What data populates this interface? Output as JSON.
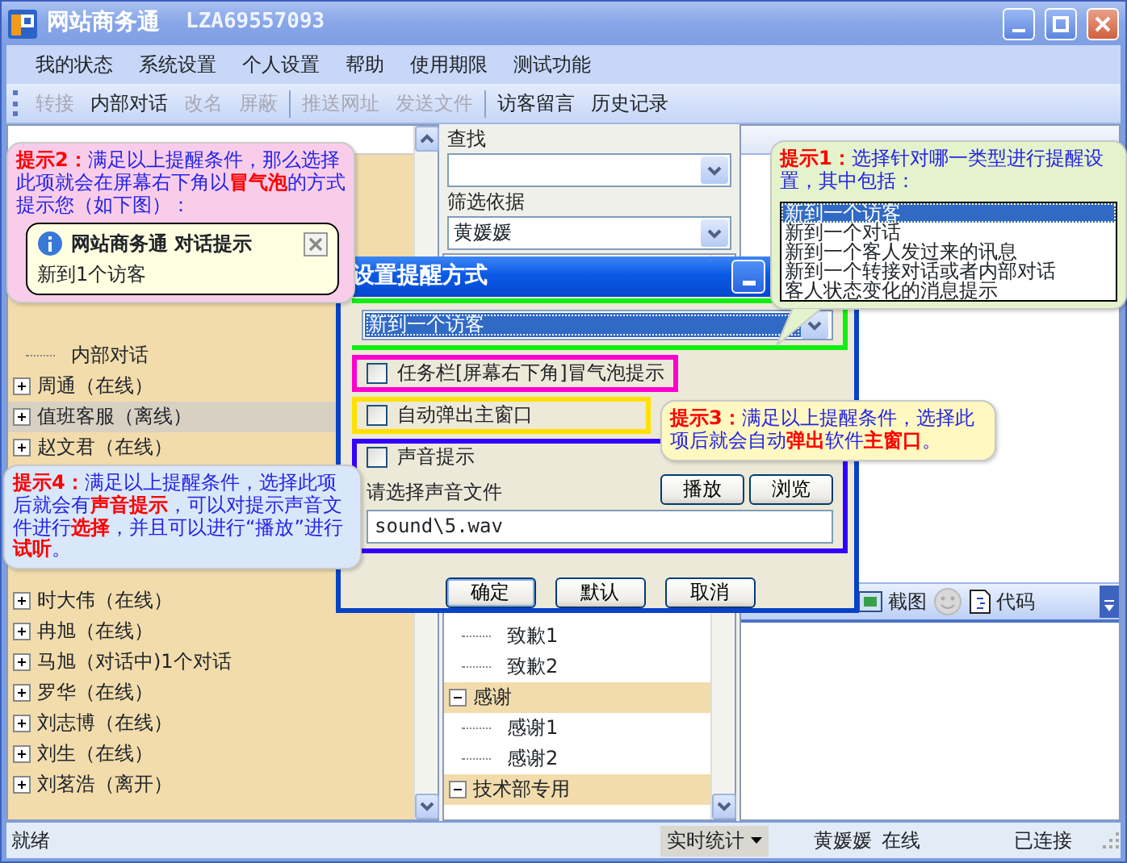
{
  "window": {
    "title": "网站商务通",
    "account": "LZA69557093"
  },
  "menu": [
    "我的状态",
    "系统设置",
    "个人设置",
    "帮助",
    "使用期限",
    "测试功能"
  ],
  "toolbar": {
    "groups": [
      [
        {
          "label": "转接",
          "disabled": true
        },
        {
          "label": "内部对话",
          "disabled": false
        },
        {
          "label": "改名",
          "disabled": true
        },
        {
          "label": "屏蔽",
          "disabled": true
        }
      ],
      [
        {
          "label": "推送网址",
          "disabled": true
        },
        {
          "label": "发送文件",
          "disabled": true
        }
      ],
      [
        {
          "label": "访客留言",
          "disabled": false
        },
        {
          "label": "历史记录",
          "disabled": false
        }
      ]
    ]
  },
  "contact_list": {
    "rows": [
      {
        "label": "内部对话",
        "kind": "leaf",
        "selected": false
      },
      {
        "label": "周通（在线）",
        "kind": "node",
        "selected": false
      },
      {
        "label": "值班客服（离线）",
        "kind": "node",
        "selected": true
      },
      {
        "label": "赵文君（在线）",
        "kind": "node",
        "selected": false
      },
      {
        "label": "时大伟（在线）",
        "kind": "node",
        "selected": false
      },
      {
        "label": "冉旭（在线）",
        "kind": "node",
        "selected": false
      },
      {
        "label": "马旭（对话中)1个对话",
        "kind": "node",
        "selected": false
      },
      {
        "label": "罗华（在线）",
        "kind": "node",
        "selected": false
      },
      {
        "label": "刘志博（在线）",
        "kind": "node",
        "selected": false
      },
      {
        "label": "刘生（在线）",
        "kind": "node",
        "selected": false
      },
      {
        "label": "刘茗浩（离开）",
        "kind": "node",
        "selected": false
      }
    ]
  },
  "search": {
    "label": "查找"
  },
  "filter": {
    "label": "筛选依据",
    "value": "黄媛媛"
  },
  "phrase_tree": [
    {
      "children": [
        {
          "label": "致歉1"
        },
        {
          "label": "致歉2"
        }
      ]
    },
    {
      "label": "感谢",
      "expanded": true,
      "children": [
        {
          "label": "感谢1"
        },
        {
          "label": "感谢2"
        }
      ]
    },
    {
      "label": "技术部专用",
      "expanded": true
    }
  ],
  "chat_toolbar": {
    "screenshot": "截图",
    "code": "代码"
  },
  "status_bar": {
    "status": "就绪",
    "stats": "实时统计",
    "user": "黄媛媛",
    "presence": "在线",
    "connection": "已连接"
  },
  "dialog": {
    "title": "设置提醒方式",
    "event_select": {
      "value": "新到一个访客"
    },
    "options": [
      {
        "kind": "check",
        "label": "任务栏[屏幕右下角]冒气泡提示",
        "checked": false,
        "color": "#ff00cc"
      },
      {
        "kind": "check",
        "label": "自动弹出主窗口",
        "checked": false,
        "color": "#ffe000"
      },
      {
        "kind": "sound",
        "label": "声音提示",
        "checked": false,
        "color": "#3300ff",
        "file_label": "请选择声音文件",
        "file": "sound\\5.wav",
        "buttons": [
          "播放",
          "浏览"
        ]
      }
    ],
    "buttons": [
      "确定",
      "默认",
      "取消"
    ]
  },
  "tips": [
    {
      "text": "**提示2：**满足以上提醒条件，那么选择此项就会在屏幕右下角以**冒气泡**的方式提示您（如下图）：",
      "color": "#f9cdea",
      "balloon": {
        "title": "网站商务通 对话提示",
        "message": "新到1个访客"
      }
    },
    {
      "text": "**提示1：**选择针对哪一类型进行提醒设置，其中包括：",
      "color": "#e4f3cc",
      "items": [
        {
          "label": "新到一个访客",
          "selected": true
        },
        {
          "label": "新到一个对话",
          "selected": false
        },
        {
          "label": "新到一个客人发过来的讯息",
          "selected": false
        },
        {
          "label": "新到一个转接对话或者内部对话",
          "selected": false
        },
        {
          "label": "客人状态变化的消息提示",
          "selected": false
        }
      ]
    },
    {
      "text": "**提示3：**满足以上提醒条件，选择此项后就会自动**弹出**软件**主窗口**。",
      "color": "#fff8c0"
    },
    {
      "text": "**提示4：**满足以上提醒条件，选择此项后就会有**声音提示**，可以对提示声音文件进行**选择**，并且可以进行“播放”进行**试听**。",
      "color": "#d9e7fb"
    }
  ]
}
